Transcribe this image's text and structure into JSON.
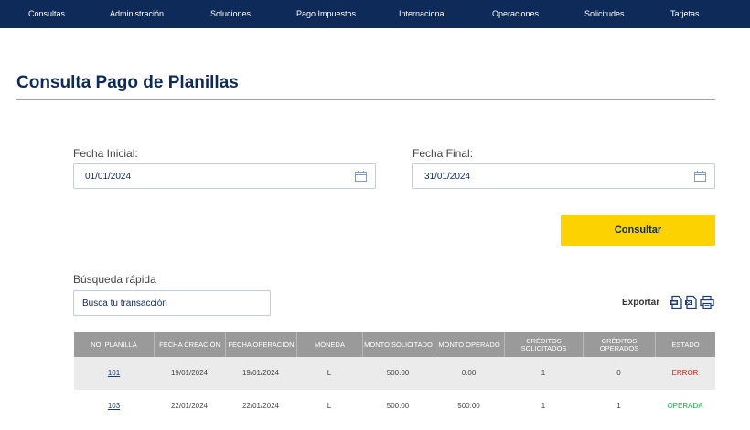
{
  "nav": {
    "items": [
      "Consultas",
      "Administración",
      "Soluciones",
      "Pago Impuestos",
      "Internacional",
      "Operaciones",
      "Solicitudes",
      "Tarjetas"
    ]
  },
  "page": {
    "title": "Consulta Pago de Planillas"
  },
  "filters": {
    "start_label": "Fecha Inicial:",
    "start_value": "01/01/2024",
    "end_label": "Fecha Final:",
    "end_value": "31/01/2024",
    "consult_label": "Consultar"
  },
  "search": {
    "label": "Búsqueda rápida",
    "placeholder": "Busca tu transacción"
  },
  "export": {
    "label": "Exportar",
    "icons": [
      "export-pdf-icon",
      "export-excel-icon",
      "print-icon"
    ]
  },
  "table": {
    "headers": [
      "No. Planilla",
      "Fecha Creación",
      "Fecha Operación",
      "Moneda",
      "Monto Solicitado",
      "Monto Operado",
      "Créditos Solicitados",
      "Créditos Operados",
      "Estado"
    ],
    "rows": [
      [
        "101",
        "19/01/2024",
        "19/01/2024",
        "L",
        "500.00",
        "0.00",
        "1",
        "0",
        "ERROR"
      ],
      [
        "103",
        "22/01/2024",
        "22/01/2024",
        "L",
        "500.00",
        "500.00",
        "1",
        "1",
        "OPERADA"
      ]
    ]
  },
  "colors": {
    "nav_bg": "#0d2a58",
    "accent": "#fcd200",
    "error": "#d0241b",
    "success": "#25a24b",
    "table_header": "#9a9a9a"
  }
}
